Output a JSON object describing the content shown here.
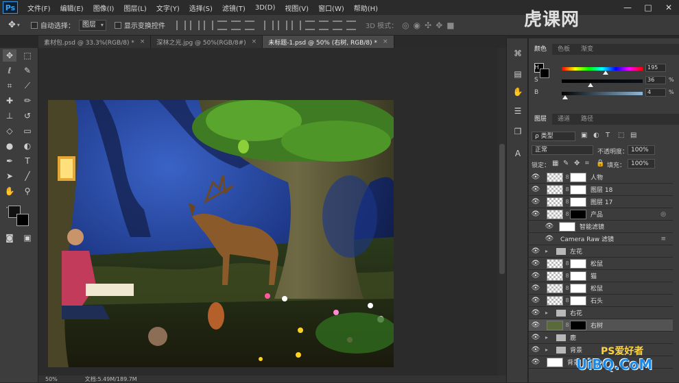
{
  "app": {
    "logo": "Ps"
  },
  "menu": [
    "文件(F)",
    "编辑(E)",
    "图像(I)",
    "图层(L)",
    "文字(Y)",
    "选择(S)",
    "滤镜(T)",
    "3D(D)",
    "视图(V)",
    "窗口(W)",
    "帮助(H)"
  ],
  "window_controls": [
    "—",
    "□",
    "✕"
  ],
  "options": {
    "auto_select_label": "自动选择：",
    "auto_select_value": "图层",
    "show_transform_label": "显示变换控件",
    "mode_3d_label": "3D 模式："
  },
  "tabs": [
    {
      "label": "素材包.psd @ 33.3%(RGB/8) *",
      "active": false
    },
    {
      "label": "深林之光.jpg @ 50%(RGB/8#)",
      "active": false
    },
    {
      "label": "未标题-1.psd @ 50% (右树, RGB/8) *",
      "active": true
    }
  ],
  "status": {
    "zoom": "50%",
    "doc": "文档:5.49M/189.7M"
  },
  "color_panel": {
    "tabs": [
      "颜色",
      "色板",
      "渐变"
    ],
    "h": {
      "label": "H",
      "value": "195",
      "unit": ""
    },
    "s": {
      "label": "S",
      "value": "36",
      "unit": "%"
    },
    "b": {
      "label": "B",
      "value": "4",
      "unit": "%"
    }
  },
  "layers_panel": {
    "tabs": [
      "图层",
      "通道",
      "路径"
    ],
    "filter_label": "ρ 类型",
    "blend_mode": "正常",
    "opacity_label": "不透明度：",
    "opacity_value": "100%",
    "lock_label": "锁定：",
    "fill_label": "填充：",
    "fill_value": "100%",
    "layers": [
      {
        "name": "人物",
        "kind": "layer",
        "mask": "white"
      },
      {
        "name": "图层 18",
        "kind": "layer",
        "mask": "white"
      },
      {
        "name": "图层 17",
        "kind": "layer",
        "mask": "white"
      },
      {
        "name": "产品",
        "kind": "layer",
        "mask": "black"
      },
      {
        "name": "智能滤镜",
        "kind": "smart-filter",
        "mask": "white"
      },
      {
        "name": "Camera Raw 滤镜",
        "kind": "filter"
      },
      {
        "name": "左花",
        "kind": "group"
      },
      {
        "name": "松鼠",
        "kind": "layer",
        "mask": "white"
      },
      {
        "name": "猫",
        "kind": "layer",
        "mask": "white"
      },
      {
        "name": "松鼠",
        "kind": "layer",
        "mask": "white"
      },
      {
        "name": "石头",
        "kind": "layer",
        "mask": "white"
      },
      {
        "name": "右花",
        "kind": "group"
      },
      {
        "name": "右树",
        "kind": "layer",
        "mask": "black",
        "selected": true
      },
      {
        "name": "鹿",
        "kind": "group"
      },
      {
        "name": "背景",
        "kind": "group"
      },
      {
        "name": "背景",
        "kind": "layer",
        "mask": "white"
      }
    ]
  },
  "watermarks": {
    "top": "虎课网",
    "bottom": "UiBQ.CoM",
    "bottom_small": "PS爱好者"
  }
}
